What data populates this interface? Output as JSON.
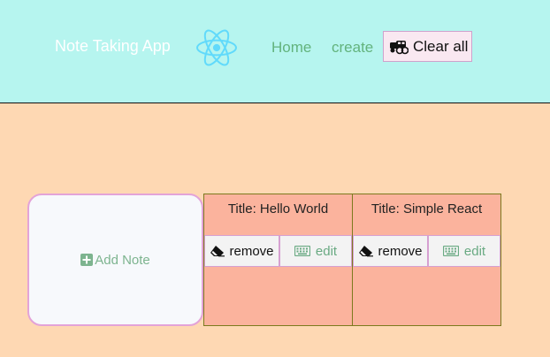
{
  "header": {
    "brand": "Note Taking App",
    "logo_icon": "react-logo-icon",
    "nav": {
      "home": "Home",
      "create": "create"
    },
    "clear_all": {
      "label": "Clear all",
      "icon": "cars-icon"
    }
  },
  "add_note": {
    "label": "Add Note",
    "icon": "plus-square-icon"
  },
  "notes": [
    {
      "title": "Title: Hello World",
      "remove_label": "remove",
      "edit_label": "edit"
    },
    {
      "title": "Title: Simple React",
      "remove_label": "remove",
      "edit_label": "edit"
    }
  ],
  "colors": {
    "header_bg": "#b6f5ef",
    "page_bg": "#fed8b3",
    "note_bg": "#fbb39d",
    "accent_green": "#63b37d",
    "react_blue": "#61dafb"
  }
}
